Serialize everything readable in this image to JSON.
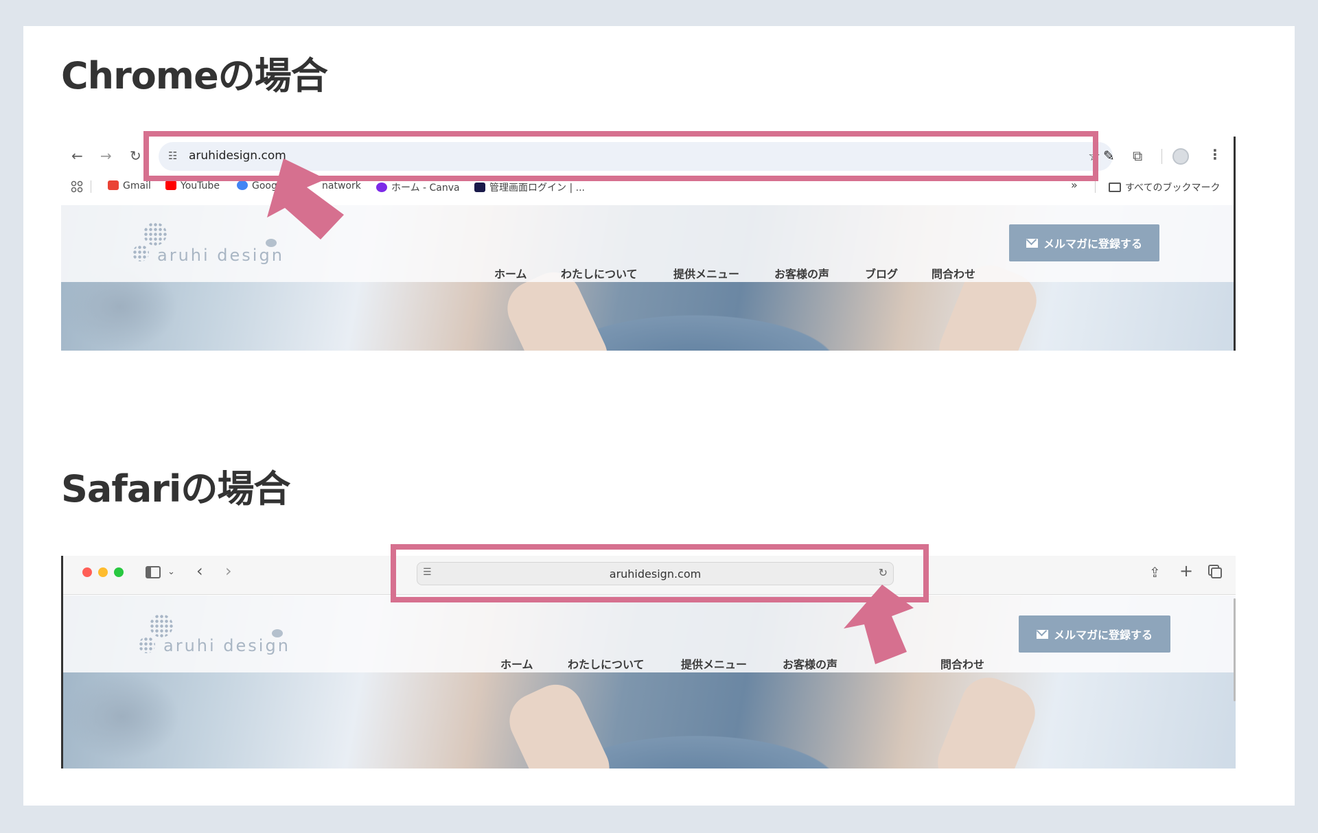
{
  "chrome_section": {
    "heading": "Chromeの場合",
    "toolbar": {
      "back_icon": "back-arrow-icon",
      "forward_icon": "forward-arrow-icon",
      "reload_icon": "reload-icon",
      "url": "aruhidesign.com",
      "site_info_icon": "tune-icon",
      "bookmark_star_icon": "star-icon",
      "eyedropper_icon": "eyedropper-icon",
      "extensions_icon": "puzzle-icon",
      "profile_icon": "avatar-icon",
      "menu_icon": "kebab-icon"
    },
    "bookmarks": {
      "apps_icon": "apps-grid-icon",
      "items": [
        {
          "label": "Gmail",
          "icon_color": "#ea4335"
        },
        {
          "label": "YouTube",
          "icon_color": "#ff0000"
        },
        {
          "label": "Google",
          "icon_color": "#4285f4"
        },
        {
          "label": "natwork",
          "icon_color": "#888888"
        },
        {
          "label": "ホーム - Canva",
          "icon_color": "#7d2ae8"
        },
        {
          "label": "管理画面ログイン | ...",
          "icon_color": "#1a1a4a"
        }
      ],
      "overflow": "»",
      "all_bookmarks": "すべてのブックマーク"
    }
  },
  "safari_section": {
    "heading": "Safariの場合",
    "toolbar": {
      "url": "aruhidesign.com",
      "traffic_lights": [
        "#ff5f57",
        "#febc2e",
        "#28c840"
      ],
      "sidebar_icon": "sidebar-icon",
      "share_icon": "share-icon",
      "new_tab_icon": "plus-icon",
      "tabs_icon": "tabs-overview-icon",
      "reload_icon": "reload-icon",
      "reader_icon": "reader-icon"
    }
  },
  "site": {
    "logo_text": "aruhi design",
    "nav": [
      "ホーム",
      "わたしについて",
      "提供メニュー",
      "お客様の声",
      "ブログ",
      "問合わせ"
    ],
    "cta_label": "メルマガに登録する",
    "cta_color": "#8ea5bb"
  },
  "highlight_color": "#d6708f"
}
